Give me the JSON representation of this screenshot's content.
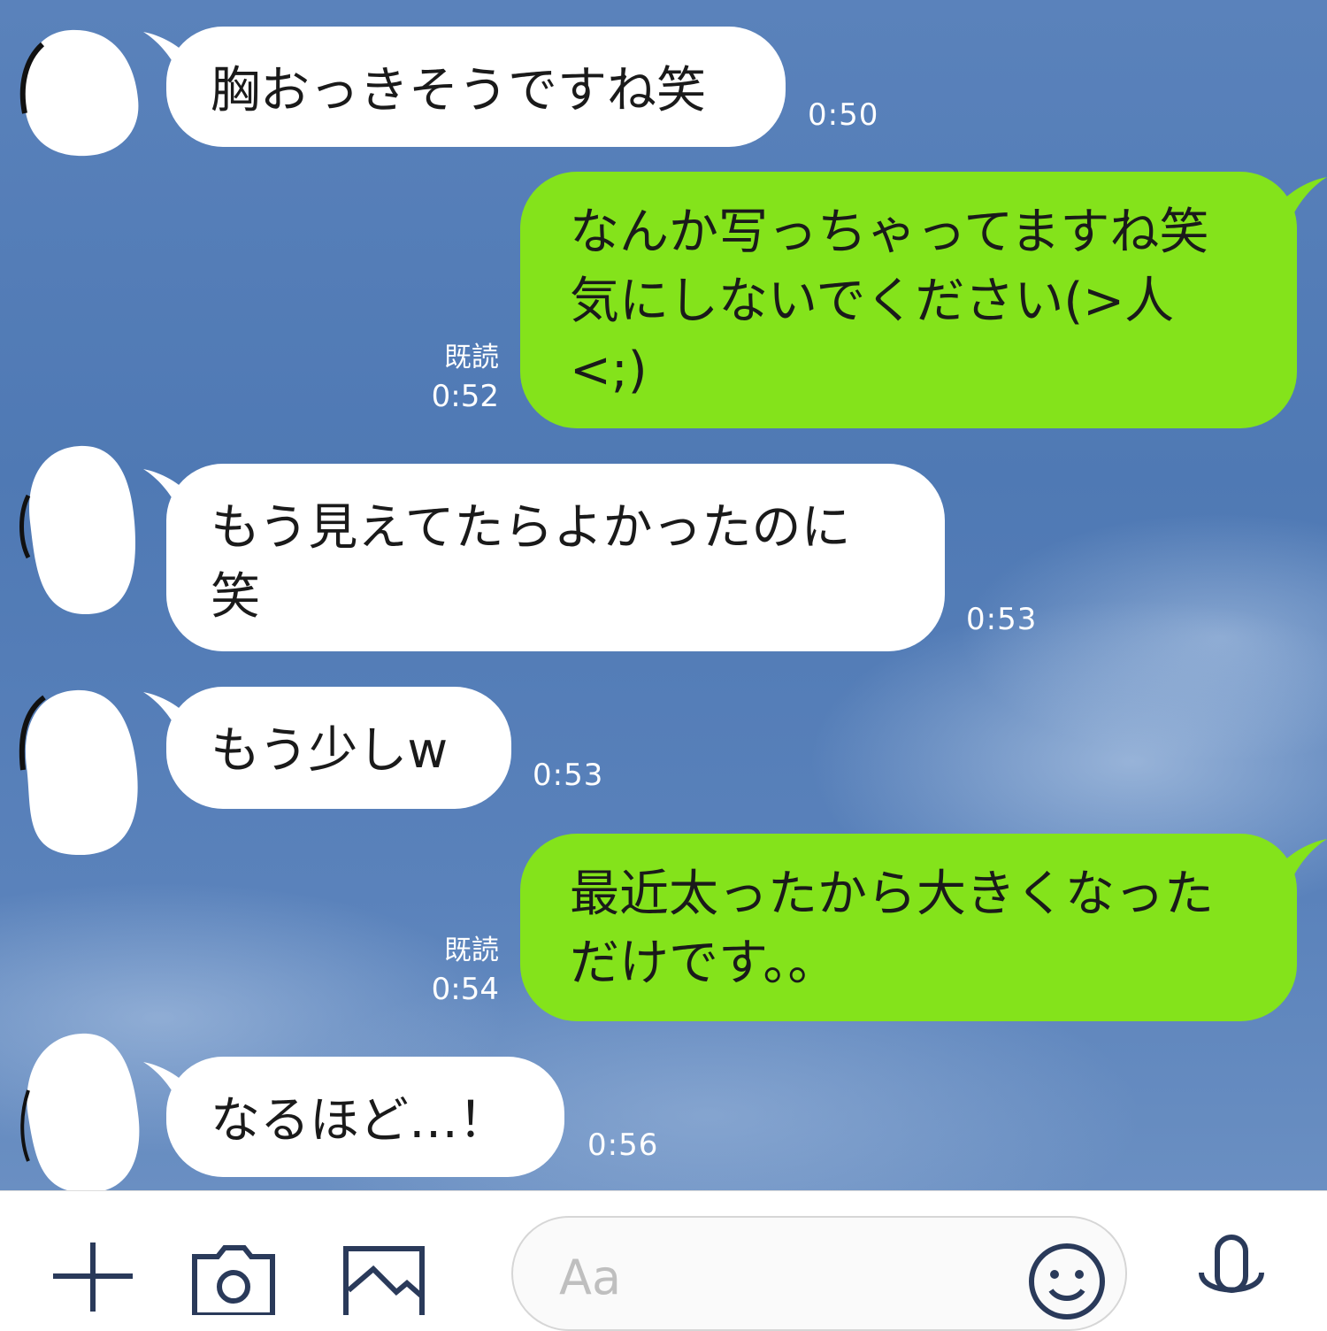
{
  "messages": [
    {
      "side": "in",
      "text": "胸おっきそうですね笑",
      "time": "0:50"
    },
    {
      "side": "out",
      "text": "なんか写っちゃってますね笑\n気にしないでください(>人\n<;)",
      "read": "既読",
      "time": "0:52"
    },
    {
      "side": "in",
      "text": "もう見えてたらよかったのに\n笑",
      "time": "0:53"
    },
    {
      "side": "in",
      "text": "もう少しw",
      "time": "0:53"
    },
    {
      "side": "out",
      "text": "最近太ったから大きくなった\nだけです。。",
      "read": "既読",
      "time": "0:54"
    },
    {
      "side": "in",
      "text": "なるほど…！",
      "time": "0:56"
    }
  ],
  "composer": {
    "placeholder": "Aa",
    "tools": [
      "plus-icon",
      "camera-icon",
      "image-icon"
    ],
    "emoji_icon": "smiley-icon",
    "mic_icon": "microphone-icon"
  },
  "colors": {
    "outgoing_bubble": "#84e31b",
    "incoming_bubble": "#ffffff",
    "background": "#5a82bb"
  }
}
